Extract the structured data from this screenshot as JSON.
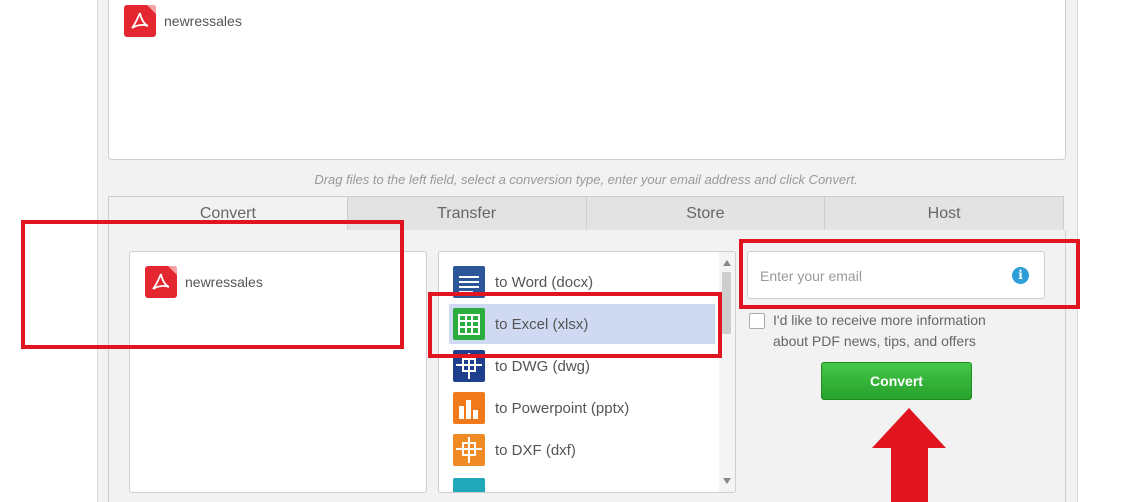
{
  "upload": {
    "files": [
      {
        "name": "newressales"
      }
    ]
  },
  "hint": "Drag files to the left field, select a conversion type, enter your email address and click Convert.",
  "tabs": [
    {
      "label": "Convert"
    },
    {
      "label": "Transfer"
    },
    {
      "label": "Store"
    },
    {
      "label": "Host"
    }
  ],
  "convert_panel": {
    "files": [
      {
        "name": "newressales"
      }
    ],
    "types": [
      {
        "label": "to Word (docx)",
        "icon": "word-icon",
        "color": "#2b579a"
      },
      {
        "label": "to Excel (xlsx)",
        "icon": "excel-icon",
        "color": "#2cae3f",
        "selected": true
      },
      {
        "label": "to DWG (dwg)",
        "icon": "dwg-icon",
        "color": "#1e3f8c"
      },
      {
        "label": "to Powerpoint (pptx)",
        "icon": "powerpoint-icon",
        "color": "#f07a1a"
      },
      {
        "label": "to DXF (dxf)",
        "icon": "dxf-icon",
        "color": "#f08a24"
      }
    ],
    "email_placeholder": "Enter your email",
    "optin_text": "I'd like to receive more information about PDF news, tips, and offers",
    "convert_label": "Convert"
  },
  "colors": {
    "accent_green": "#2fb133",
    "highlight_red": "#e0151f",
    "selection_blue": "#cfd9f2"
  }
}
